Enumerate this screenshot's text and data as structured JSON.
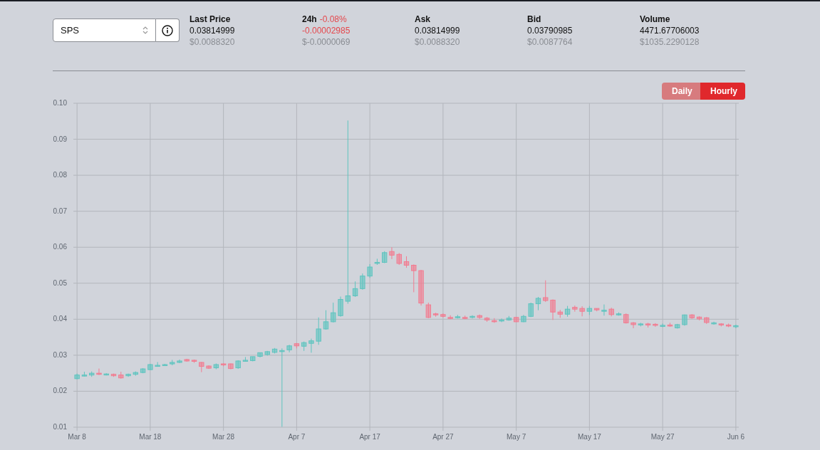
{
  "pair_select": {
    "value": "SPS"
  },
  "stats": [
    {
      "label": "Last Price",
      "value": "0.03814999",
      "usd": "$0.0088320",
      "negative": false
    },
    {
      "label": "24h",
      "change": "-0.08%",
      "value": "-0.00002985",
      "usd": "$-0.0000069",
      "negative": true
    },
    {
      "label": "Ask",
      "value": "0.03814999",
      "usd": "$0.0088320",
      "negative": false
    },
    {
      "label": "Bid",
      "value": "0.03790985",
      "usd": "$0.0087764",
      "negative": false
    },
    {
      "label": "Volume",
      "value": "4471.67706003",
      "usd": "$1035.2290128",
      "negative": false
    }
  ],
  "interval_buttons": [
    {
      "label": "Daily",
      "selected": false
    },
    {
      "label": "Hourly",
      "selected": true
    }
  ],
  "chart": {
    "chart_data": {
      "type": "candlestick",
      "grid": true,
      "ylim": [
        0.01,
        0.1
      ],
      "yticks": [
        {
          "value": 0.01,
          "label": "0.01"
        },
        {
          "value": 0.02,
          "label": "0.02"
        },
        {
          "value": 0.03,
          "label": "0.03"
        },
        {
          "value": 0.04,
          "label": "0.04"
        },
        {
          "value": 0.05,
          "label": "0.05"
        },
        {
          "value": 0.06,
          "label": "0.06"
        },
        {
          "value": 0.07,
          "label": "0.07"
        },
        {
          "value": 0.08,
          "label": "0.08"
        },
        {
          "value": 0.09,
          "label": "0.09"
        },
        {
          "value": 0.1,
          "label": "0.10"
        }
      ],
      "categories": [
        "Mar 8",
        null,
        null,
        null,
        null,
        null,
        null,
        null,
        null,
        null,
        "Mar 18",
        null,
        null,
        null,
        null,
        null,
        null,
        null,
        null,
        null,
        "Mar 28",
        null,
        null,
        null,
        null,
        null,
        null,
        null,
        null,
        null,
        "Apr 7",
        null,
        null,
        null,
        null,
        null,
        null,
        null,
        null,
        null,
        "Apr 17",
        null,
        null,
        null,
        null,
        null,
        null,
        null,
        null,
        null,
        "Apr 27",
        null,
        null,
        null,
        null,
        null,
        null,
        null,
        null,
        null,
        "May 7",
        null,
        null,
        null,
        null,
        null,
        null,
        null,
        null,
        null,
        "May 17",
        null,
        null,
        null,
        null,
        null,
        null,
        null,
        null,
        null,
        "May 27",
        null,
        null,
        null,
        null,
        null,
        null,
        null,
        null,
        null,
        "Jun 6"
      ],
      "ohlc": [
        [
          0.0235,
          0.0249,
          0.0233,
          0.0245
        ],
        [
          0.0245,
          0.0254,
          0.0241,
          0.0245
        ],
        [
          0.0245,
          0.0255,
          0.024,
          0.025
        ],
        [
          0.025,
          0.0263,
          0.0245,
          0.0247
        ],
        [
          0.0247,
          0.025,
          0.0244,
          0.0248
        ],
        [
          0.0247,
          0.0249,
          0.024,
          0.0243
        ],
        [
          0.0245,
          0.0254,
          0.0235,
          0.0237
        ],
        [
          0.0243,
          0.0249,
          0.024,
          0.0247
        ],
        [
          0.0247,
          0.0255,
          0.0243,
          0.0252
        ],
        [
          0.0252,
          0.0264,
          0.025,
          0.0262
        ],
        [
          0.026,
          0.0276,
          0.0259,
          0.0274
        ],
        [
          0.027,
          0.0281,
          0.0268,
          0.0272
        ],
        [
          0.0273,
          0.0276,
          0.0272,
          0.0274
        ],
        [
          0.0276,
          0.0287,
          0.0272,
          0.028
        ],
        [
          0.028,
          0.0288,
          0.0278,
          0.0284
        ],
        [
          0.0288,
          0.029,
          0.0282,
          0.0284
        ],
        [
          0.0286,
          0.0288,
          0.0279,
          0.0283
        ],
        [
          0.028,
          0.0281,
          0.0253,
          0.0269
        ],
        [
          0.027,
          0.0272,
          0.0262,
          0.0264
        ],
        [
          0.0265,
          0.0277,
          0.0261,
          0.0274
        ],
        [
          0.0276,
          0.0278,
          0.0269,
          0.0274
        ],
        [
          0.0276,
          0.0277,
          0.0261,
          0.0263
        ],
        [
          0.0265,
          0.0286,
          0.0262,
          0.0284
        ],
        [
          0.0284,
          0.0295,
          0.0282,
          0.0286
        ],
        [
          0.0285,
          0.0296,
          0.0283,
          0.0296
        ],
        [
          0.0297,
          0.0307,
          0.0294,
          0.0307
        ],
        [
          0.0302,
          0.0312,
          0.0299,
          0.031
        ],
        [
          0.0308,
          0.032,
          0.0305,
          0.0317
        ],
        [
          0.0313,
          0.0319,
          0.0101,
          0.0313
        ],
        [
          0.0315,
          0.0329,
          0.0308,
          0.0326
        ],
        [
          0.0332,
          0.0334,
          0.0319,
          0.0326
        ],
        [
          0.0325,
          0.0338,
          0.0312,
          0.0335
        ],
        [
          0.0333,
          0.0346,
          0.0307,
          0.034
        ],
        [
          0.0339,
          0.0405,
          0.0329,
          0.0373
        ],
        [
          0.0373,
          0.0425,
          0.0371,
          0.0393
        ],
        [
          0.0393,
          0.0446,
          0.0391,
          0.0418
        ],
        [
          0.041,
          0.0463,
          0.0407,
          0.0455
        ],
        [
          0.045,
          0.0952,
          0.0443,
          0.0465
        ],
        [
          0.0465,
          0.0505,
          0.0462,
          0.0485
        ],
        [
          0.0485,
          0.0527,
          0.0482,
          0.052
        ],
        [
          0.052,
          0.0553,
          0.0515,
          0.0545
        ],
        [
          0.0555,
          0.0568,
          0.0551,
          0.0558
        ],
        [
          0.0558,
          0.0589,
          0.0556,
          0.0585
        ],
        [
          0.0588,
          0.06,
          0.0567,
          0.0578
        ],
        [
          0.058,
          0.0584,
          0.0551,
          0.0555
        ],
        [
          0.056,
          0.0575,
          0.0543,
          0.055
        ],
        [
          0.055,
          0.0552,
          0.0475,
          0.0535
        ],
        [
          0.0535,
          0.0537,
          0.0438,
          0.0445
        ],
        [
          0.044,
          0.0446,
          0.0403,
          0.0405
        ],
        [
          0.0415,
          0.0418,
          0.0407,
          0.0413
        ],
        [
          0.0413,
          0.0416,
          0.0405,
          0.0408
        ],
        [
          0.0405,
          0.0411,
          0.04,
          0.0403
        ],
        [
          0.0405,
          0.0412,
          0.0402,
          0.0407
        ],
        [
          0.0405,
          0.041,
          0.04,
          0.0403
        ],
        [
          0.0405,
          0.0411,
          0.0402,
          0.0408
        ],
        [
          0.041,
          0.0413,
          0.0401,
          0.0405
        ],
        [
          0.0403,
          0.0406,
          0.0393,
          0.0398
        ],
        [
          0.0396,
          0.0403,
          0.039,
          0.0394
        ],
        [
          0.0395,
          0.0402,
          0.0392,
          0.0398
        ],
        [
          0.0398,
          0.0409,
          0.0396,
          0.0403
        ],
        [
          0.0405,
          0.0406,
          0.0392,
          0.0393
        ],
        [
          0.0393,
          0.0412,
          0.0392,
          0.0408
        ],
        [
          0.0408,
          0.0446,
          0.0406,
          0.0443
        ],
        [
          0.0443,
          0.0462,
          0.0425,
          0.0458
        ],
        [
          0.046,
          0.0508,
          0.0448,
          0.0452
        ],
        [
          0.0453,
          0.0455,
          0.0398,
          0.042
        ],
        [
          0.042,
          0.0426,
          0.0404,
          0.0414
        ],
        [
          0.0414,
          0.0437,
          0.0407,
          0.0428
        ],
        [
          0.0433,
          0.0438,
          0.0421,
          0.0428
        ],
        [
          0.043,
          0.0436,
          0.0408,
          0.0422
        ],
        [
          0.0422,
          0.0437,
          0.0412,
          0.043
        ],
        [
          0.043,
          0.043,
          0.0422,
          0.0426
        ],
        [
          0.0425,
          0.0441,
          0.041,
          0.0425
        ],
        [
          0.0428,
          0.0432,
          0.0408,
          0.0413
        ],
        [
          0.0413,
          0.0419,
          0.041,
          0.0415
        ],
        [
          0.0413,
          0.0416,
          0.0388,
          0.039
        ],
        [
          0.039,
          0.0392,
          0.0375,
          0.0385
        ],
        [
          0.0385,
          0.039,
          0.038,
          0.0387
        ],
        [
          0.0387,
          0.039,
          0.0377,
          0.0384
        ],
        [
          0.0386,
          0.0389,
          0.0379,
          0.0383
        ],
        [
          0.0383,
          0.0388,
          0.0378,
          0.0383
        ],
        [
          0.0384,
          0.039,
          0.0379,
          0.0382
        ],
        [
          0.0376,
          0.0387,
          0.0374,
          0.0385
        ],
        [
          0.0385,
          0.0413,
          0.0382,
          0.0412
        ],
        [
          0.0412,
          0.0414,
          0.0401,
          0.0404
        ],
        [
          0.0406,
          0.0408,
          0.0397,
          0.0401
        ],
        [
          0.0404,
          0.0406,
          0.0387,
          0.0391
        ],
        [
          0.0388,
          0.0393,
          0.0385,
          0.039
        ],
        [
          0.0387,
          0.0389,
          0.038,
          0.0384
        ],
        [
          0.0384,
          0.0388,
          0.0378,
          0.0381
        ],
        [
          0.0381,
          0.0385,
          0.0375,
          0.0382
        ]
      ]
    }
  }
}
